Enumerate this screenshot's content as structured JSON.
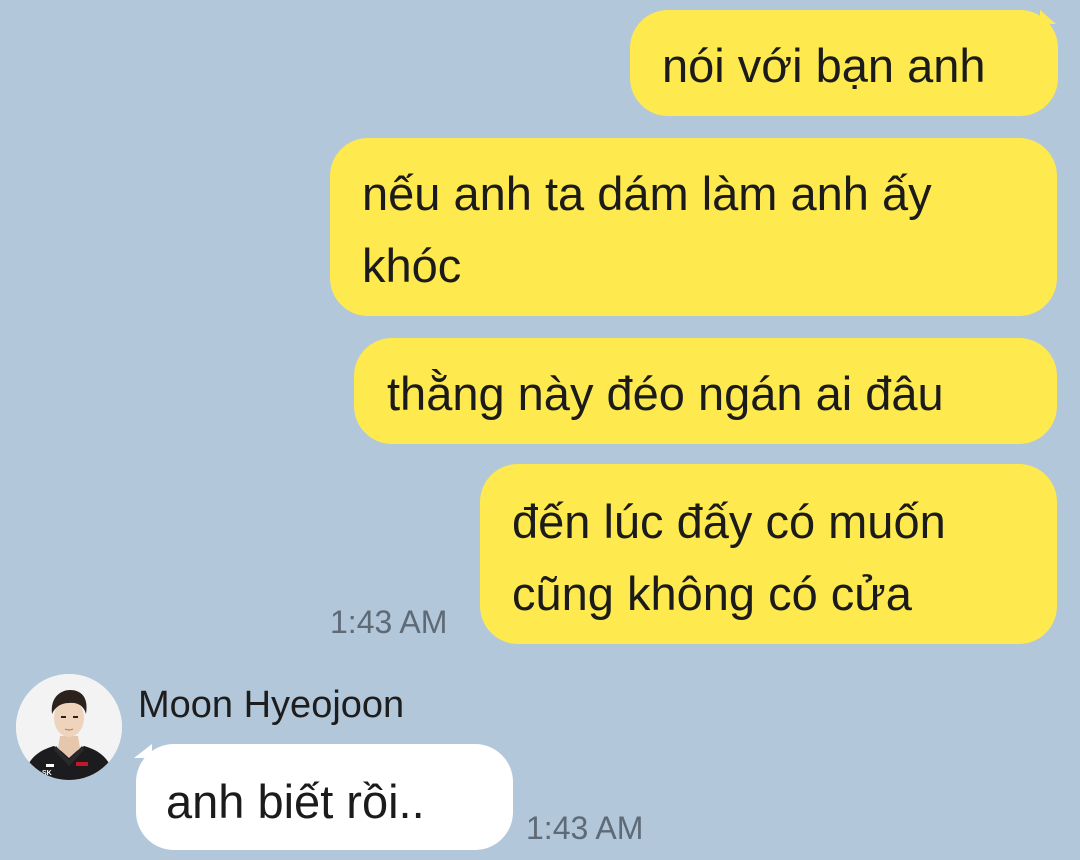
{
  "messages": [
    {
      "direction": "out",
      "text": "nói với bạn anh"
    },
    {
      "direction": "out",
      "line1": "nếu anh ta dám làm anh ấy",
      "line2": "khóc"
    },
    {
      "direction": "out",
      "text": "thằng này đéo ngán ai đâu"
    },
    {
      "direction": "out",
      "line1": "đến lúc đấy có muốn",
      "line2": "cũng không có cửa",
      "time": "1:43 AM"
    },
    {
      "direction": "in",
      "sender": "Moon Hyeojoon",
      "text": "anh biết rồi..",
      "time": "1:43 AM",
      "avatar": "avatar-photo"
    }
  ],
  "colors": {
    "background": "#b2c7da",
    "outgoing_bubble": "#fee94f",
    "incoming_bubble": "#ffffff",
    "timestamp": "#5e6a76"
  }
}
